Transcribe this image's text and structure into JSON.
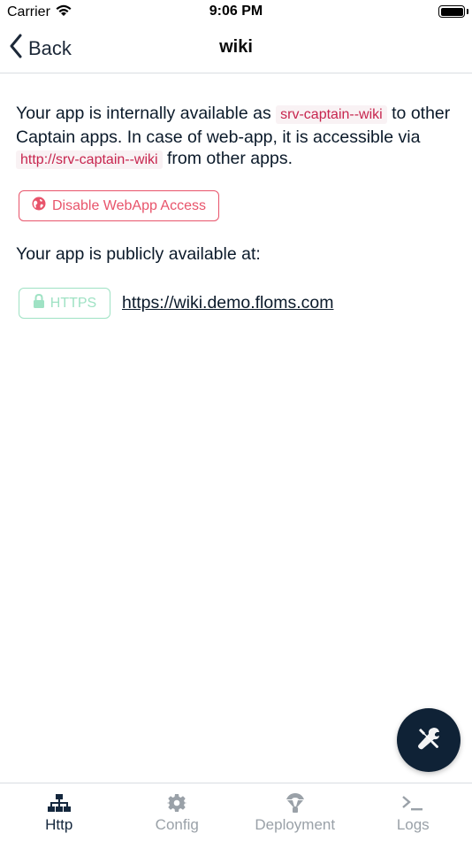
{
  "status_bar": {
    "carrier": "Carrier",
    "time": "9:06 PM"
  },
  "nav": {
    "back_label": "Back",
    "title": "wiki"
  },
  "http": {
    "intro_part1": "Your app is internally available as ",
    "internal_name": "srv-captain--wiki",
    "intro_part2": " to other Captain apps. In case of web-app, it is accessible via ",
    "internal_url": "http://srv-captain--wiki",
    "intro_part3": " from other apps.",
    "disable_button_label": "Disable WebApp Access",
    "public_text": "Your app is publicly available at:",
    "https_badge_label": "HTTPS",
    "public_url": "https://wiki.demo.floms.com"
  },
  "tabs": [
    {
      "label": "Http",
      "icon": "network-icon",
      "active": true
    },
    {
      "label": "Config",
      "icon": "gear-icon",
      "active": false
    },
    {
      "label": "Deployment",
      "icon": "deploy-icon",
      "active": false
    },
    {
      "label": "Logs",
      "icon": "terminal-icon",
      "active": false
    }
  ],
  "colors": {
    "accent_dark": "#0f2236",
    "danger": "#e8546b",
    "success_light": "#9fe2c4",
    "code_text": "#c7254e",
    "code_bg": "#f9f2f4",
    "tab_inactive": "#9aa1a8"
  }
}
